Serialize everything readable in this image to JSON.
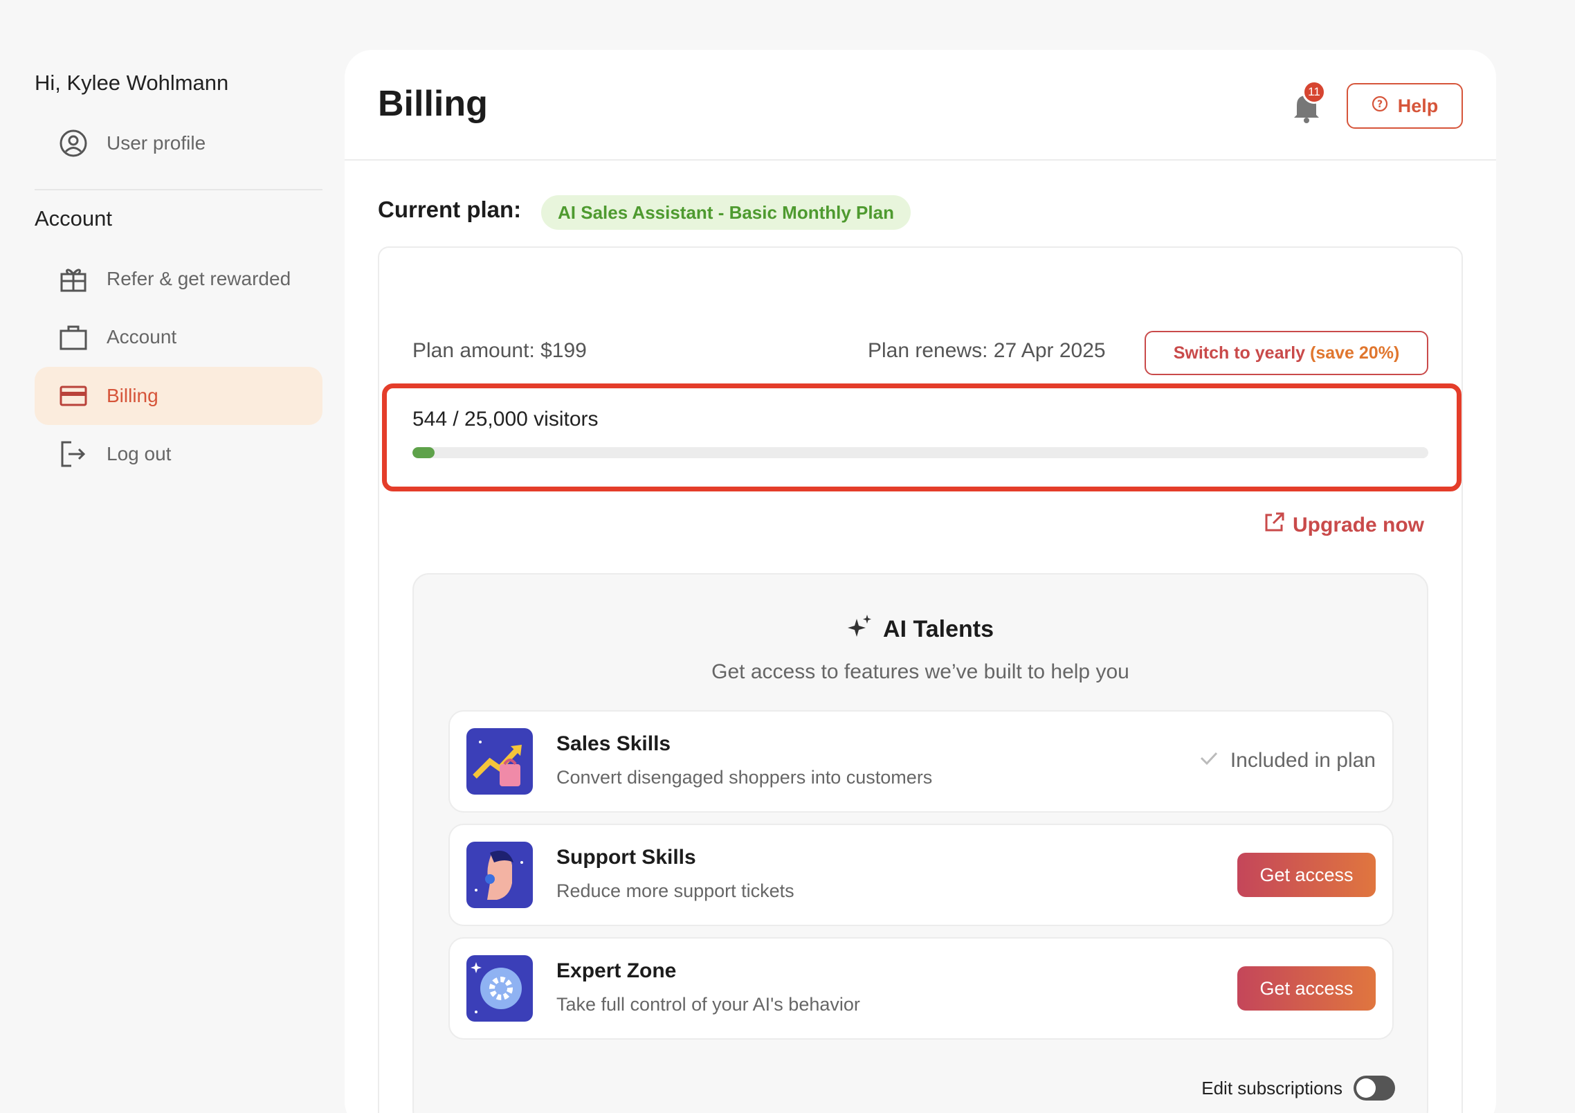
{
  "sidebar": {
    "greeting": "Hi, Kylee Wohlmann",
    "profile_item": "User profile",
    "section_title": "Account",
    "items": [
      {
        "label": "Refer & get rewarded",
        "icon": "gift-icon"
      },
      {
        "label": "Account",
        "icon": "briefcase-icon"
      },
      {
        "label": "Billing",
        "icon": "credit-card-icon",
        "active": true
      },
      {
        "label": "Log out",
        "icon": "logout-icon"
      }
    ]
  },
  "header": {
    "title": "Billing",
    "notification_count": "11",
    "help_label": "Help"
  },
  "plan": {
    "current_label": "Current plan:",
    "name": "AI Sales Assistant - Basic Monthly Plan",
    "amount": "Plan amount: $199",
    "renews": "Plan renews: 27 Apr 2025",
    "switch_label": "Switch to yearly ",
    "switch_highlight": "(save 20%)",
    "usage_text": "544 / 25,000 visitors",
    "usage_fraction": 0.02176,
    "upgrade_label": "Upgrade now"
  },
  "talents": {
    "title": "AI Talents",
    "subtitle": "Get access to features we’ve built to help you",
    "items": [
      {
        "name": "Sales Skills",
        "desc": "Convert disengaged shoppers into customers",
        "status": "Included in plan"
      },
      {
        "name": "Support Skills",
        "desc": "Reduce more support tickets",
        "button": "Get access"
      },
      {
        "name": "Expert Zone",
        "desc": "Take full control of your AI's behavior",
        "button": "Get access"
      }
    ],
    "edit_subscriptions": "Edit subscriptions"
  },
  "colors": {
    "accent": "#d6553a",
    "active_bg": "#fbecdd",
    "plan_badge_bg": "#e8f5dc",
    "plan_badge_text": "#4e9a2f",
    "progress": "#5ea24a",
    "highlight_border": "#e43d2a"
  }
}
